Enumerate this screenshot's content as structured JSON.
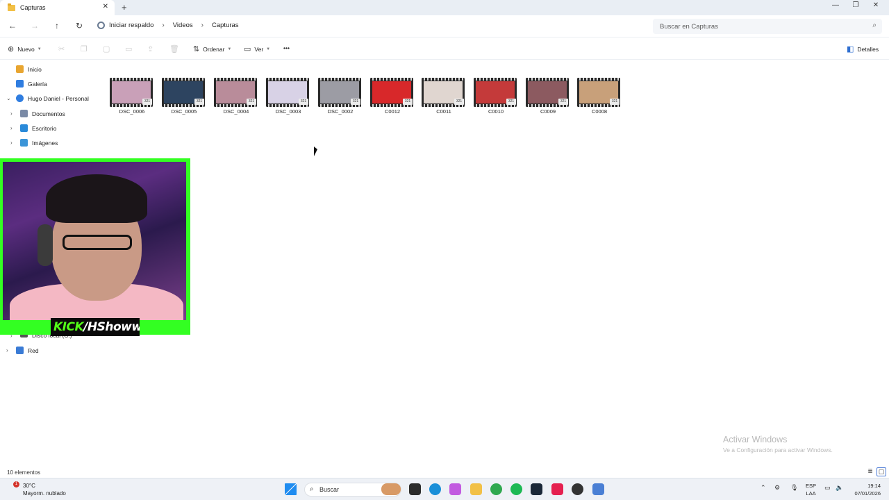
{
  "window": {
    "tab_title": "Capturas",
    "new_tab": "+",
    "close_tab": "✕",
    "minimize": "—",
    "maximize": "❐",
    "close": "✕"
  },
  "address": {
    "crumbs": [
      "Iniciar respaldo",
      "Videos",
      "Capturas"
    ],
    "separator": "›",
    "search_placeholder": "Buscar en Capturas"
  },
  "commands": {
    "new_label": "Nuevo",
    "sort_label": "Ordenar",
    "view_label": "Ver",
    "more_label": "•••",
    "details_label": "Detalles"
  },
  "sidebar": {
    "items": [
      {
        "label": "Inicio",
        "icon": "home-icon",
        "color": "#e8a530"
      },
      {
        "label": "Galería",
        "icon": "gallery-icon",
        "color": "#2f7de0"
      },
      {
        "label": "Hugo Daniel - Personal",
        "icon": "cloud-icon",
        "color": "#2f7de0"
      },
      {
        "label": "Documentos",
        "icon": "documents-icon",
        "color": "#7a8aa6"
      },
      {
        "label": "Escritorio",
        "icon": "desktop-icon",
        "color": "#2a8ad9"
      },
      {
        "label": "Imágenes",
        "icon": "pictures-icon",
        "color": "#3b95d8"
      },
      {
        "label": "Disco local (C:)",
        "icon": "drive-icon",
        "color": "#555555"
      },
      {
        "label": "Red",
        "icon": "network-icon",
        "color": "#3a7bd5"
      }
    ]
  },
  "files": [
    {
      "name": "DSC_0006",
      "scene": "#c9a0b8"
    },
    {
      "name": "DSC_0005",
      "scene": "#2d4460"
    },
    {
      "name": "DSC_0004",
      "scene": "#b98c9a"
    },
    {
      "name": "DSC_0003",
      "scene": "#d8d2e6"
    },
    {
      "name": "DSC_0002",
      "scene": "#9c9ca4"
    },
    {
      "name": "C0012",
      "scene": "#d8282a"
    },
    {
      "name": "C0011",
      "scene": "#e0d6d0"
    },
    {
      "name": "C0010",
      "scene": "#c43a3a"
    },
    {
      "name": "C0009",
      "scene": "#8c5a60"
    },
    {
      "name": "C0008",
      "scene": "#c8a07a"
    }
  ],
  "file_badge": "321",
  "webcam": {
    "label_a": "KICK",
    "label_b": "/HShoww"
  },
  "status": {
    "count": "10 elementos"
  },
  "watermark": {
    "title": "Activar Windows",
    "subtitle": "Ve a Configuración para activar Windows."
  },
  "taskbar": {
    "weather_temp": "30°C",
    "weather_desc": "Mayorm. nublado",
    "weather_alert": "1",
    "search_label": "Buscar",
    "lang_1": "ESP",
    "lang_2": "LAA",
    "time": "19:14",
    "date": "07/01/2026"
  }
}
